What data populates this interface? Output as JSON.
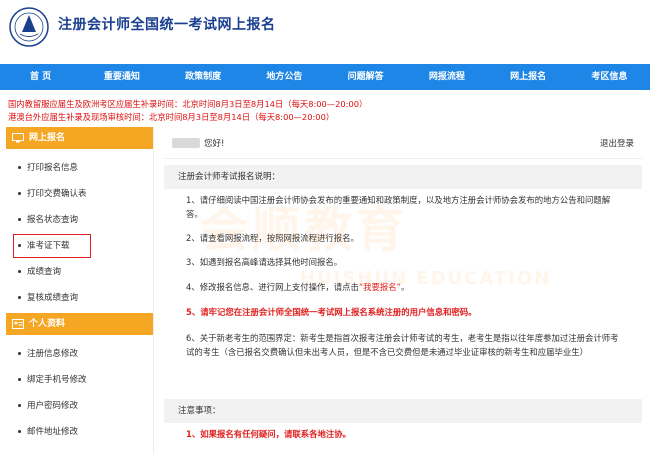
{
  "header": {
    "site_title": "注册会计师全国统一考试网上报名"
  },
  "nav": [
    "首 页",
    "重要通知",
    "政策制度",
    "地方公告",
    "问题解答",
    "网报流程",
    "网上报名",
    "考区信息"
  ],
  "notices": [
    "国内教留服应届生及欧洲考区应届生补录时间：北京时间8月3日至8月14日（每天8:00—20:00）",
    "港澳台外应届生补录及现场审核时间：北京时间8月3日至8月14日（每天8:00—20:00）"
  ],
  "sidebar": {
    "section1_title": "网上报名",
    "section1_items": [
      "打印报名信息",
      "打印交费确认表",
      "报名状态查询",
      "准考证下载",
      "成绩查询",
      "复核成绩查询"
    ],
    "section2_title": "个人资料",
    "section2_items": [
      "注册信息修改",
      "绑定手机号修改",
      "用户密码修改",
      "邮件地址修改"
    ],
    "highlight_color": "#e02020"
  },
  "main": {
    "greeting": "您好!",
    "logout": "退出登录",
    "instructions_title": "注册会计师考试报名说明：",
    "p1": "1、请仔细阅读中国注册会计师协会发布的重要通知和政策制度，以及地方注册会计师协会发布的地方公告和问题解答。",
    "p2": "2、请查看网报流程，按照网报流程进行报名。",
    "p3": "3、如遇到报名高峰请选择其他时间报名。",
    "p4_prefix": "4、修改报名信息、进行网上支付操作，请点击",
    "p4_link": "“我要报名”",
    "p4_suffix": "。",
    "p5": "5、请牢记您在注册会计师全国统一考试网上报名系统注册的用户信息和密码。",
    "p6": "6、关于新老考生的范围界定：新考生是指首次报考注册会计师考试的考生，老考生是指以往年度参加过注册会计师考试的考生（含已报名交费确认但未出考人员，但是不含已交费但是未通过毕业证审核的新考生和应届毕业生）",
    "notes_title": "注意事项：",
    "note1": "1、如果报名有任何疑问，请联系各地注协。"
  },
  "watermark": {
    "cn": "会顺教育",
    "en": "HUISHUN EDUCATION"
  },
  "colors": {
    "nav_bg": "#1e86e6",
    "sidebar_head": "#f5a623",
    "title_blue": "#1a3f8f",
    "alert_red": "#e02020"
  }
}
